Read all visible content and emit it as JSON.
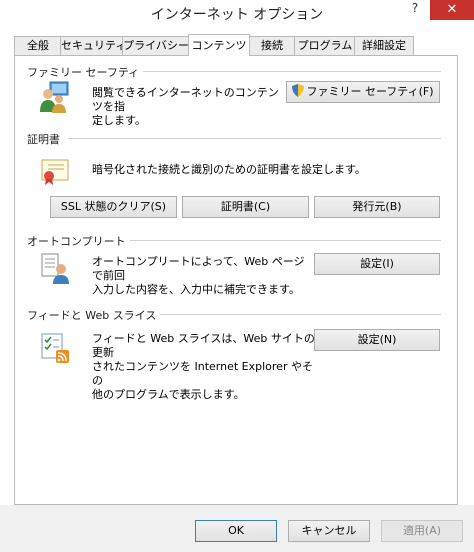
{
  "window": {
    "title": "インターネット オプション",
    "help": "?",
    "close": "✕"
  },
  "tabs": [
    "全般",
    "セキュリティ",
    "プライバシー",
    "コンテンツ",
    "接続",
    "プログラム",
    "詳細設定"
  ],
  "active_tab": 3,
  "family_safety": {
    "group": "ファミリー セーフティ",
    "description": [
      "閲覧できるインターネットのコンテンツを指",
      "定します。"
    ],
    "button": "ファミリー セーフティ(F)"
  },
  "certificates": {
    "group": "証明書",
    "description": "暗号化された接続と識別のための証明書を設定します。",
    "ssl_button": "SSL 状態のクリア(S)",
    "certs_button": "証明書(C)",
    "publishers_button": "発行元(B)"
  },
  "autocomplete": {
    "group": "オートコンプリート",
    "description": [
      "オートコンプリートによって、Web ページで前回",
      "入力した内容を、入力中に補完できます。"
    ],
    "settings_button": "設定(I)"
  },
  "feeds": {
    "group": "フィードと Web スライス",
    "description": [
      "フィードと Web スライスは、Web サイトの更新",
      "されたコンテンツを Internet Explorer やその",
      "他のプログラムで表示します。"
    ],
    "settings_button": "設定(N)"
  },
  "footer": {
    "ok": "OK",
    "cancel": "キャンセル",
    "apply": "適用(A)"
  }
}
